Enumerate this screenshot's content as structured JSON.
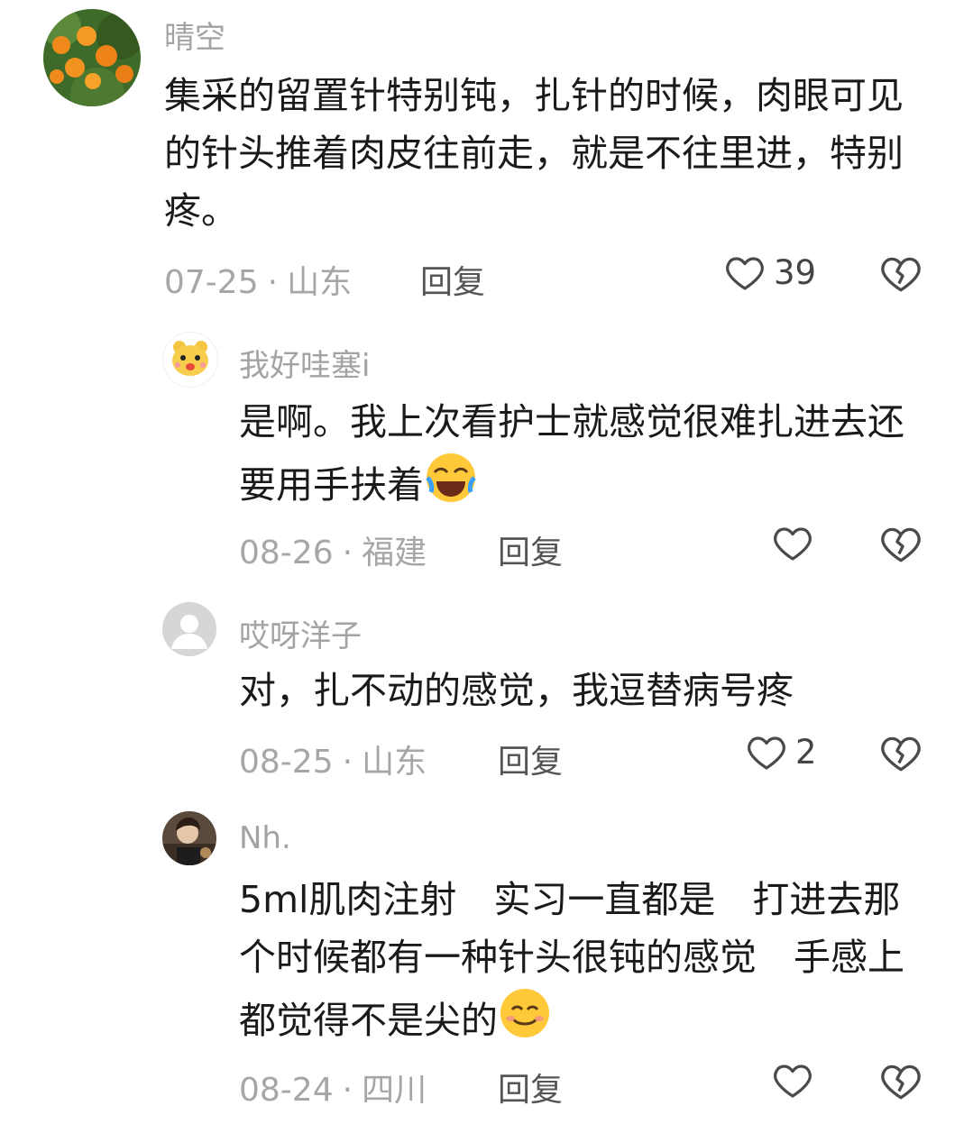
{
  "comments": [
    {
      "username": "晴空",
      "text": "集采的留置针特别钝，扎针的时候，肉眼可见的针头推着肉皮往前走，就是不往里进，特别疼。",
      "date": "07-25",
      "location": "山东",
      "reply_label": "回复",
      "likes": "39"
    },
    {
      "username": "我好哇塞i",
      "text": "是啊。我上次看护士就感觉很难扎进去还要用手扶着",
      "date": "08-26",
      "location": "福建",
      "reply_label": "回复",
      "likes": ""
    },
    {
      "username": "哎呀洋子",
      "text": "对，扎不动的感觉，我逗替病号疼",
      "date": "08-25",
      "location": "山东",
      "reply_label": "回复",
      "likes": "2"
    },
    {
      "username": "Nh.",
      "text": "5ml肌肉注射　实习一直都是　打进去那个时候都有一种针头很钝的感觉　手感上都觉得不是尖的",
      "date": "08-24",
      "location": "四川",
      "reply_label": "回复",
      "likes": ""
    }
  ],
  "meta_separator": "·",
  "icons": [
    "heart-outline-icon",
    "broken-heart-icon",
    "laughing-crying-emoji",
    "smiling-emoji",
    "default-avatar-icon"
  ],
  "colors": {
    "username": "#a3a3a3",
    "meta": "#a6a6a6",
    "text": "#1a1a1a",
    "reply": "#555555"
  }
}
